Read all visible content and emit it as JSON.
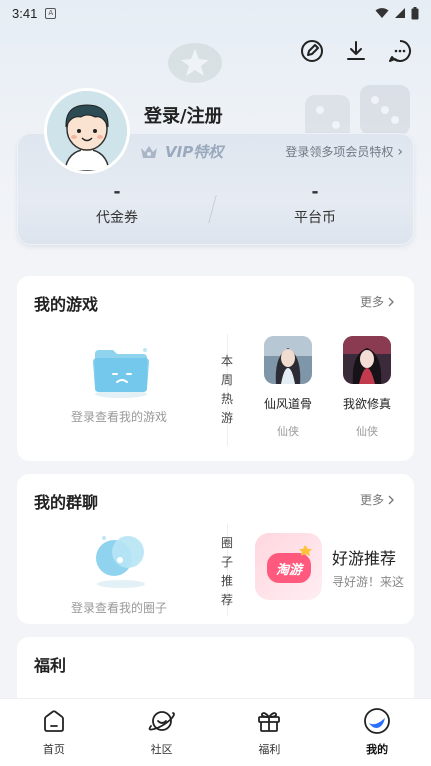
{
  "status_bar": {
    "time": "3:41",
    "app_icon": "A"
  },
  "profile": {
    "login_label": "登录/注册"
  },
  "vip": {
    "badge": "VIP特权",
    "link": "登录领多项会员特权",
    "link_arrow": "›"
  },
  "stats": [
    {
      "value": "-",
      "label": "代金券"
    },
    {
      "value": "-",
      "label": "平台币"
    }
  ],
  "my_games": {
    "title": "我的游戏",
    "more": "更多",
    "empty_text": "登录查看我的游戏",
    "side_label": [
      "本",
      "周",
      "热",
      "游"
    ],
    "games": [
      {
        "name": "仙风道骨",
        "tag": "仙侠"
      },
      {
        "name": "我欲修真",
        "tag": "仙侠"
      }
    ]
  },
  "my_groups": {
    "title": "我的群聊",
    "more": "更多",
    "empty_text": "登录查看我的圈子",
    "side_label": [
      "圈",
      "子",
      "推",
      "荐"
    ],
    "recommend": {
      "name": "好游推荐",
      "desc": "寻好游！来这",
      "logo_text": "淘游"
    }
  },
  "welfare": {
    "title": "福利"
  },
  "tabs": [
    {
      "label": "首页",
      "icon": "home-icon"
    },
    {
      "label": "社区",
      "icon": "planet-icon"
    },
    {
      "label": "福利",
      "icon": "gift-icon"
    },
    {
      "label": "我的",
      "icon": "profile-icon"
    }
  ],
  "colors": {
    "accent": "#2b6fff",
    "background": "#f3f4f7",
    "vip_text": "#9aa9bd"
  }
}
